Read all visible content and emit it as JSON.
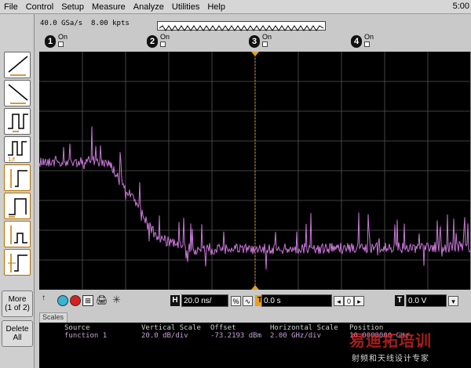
{
  "menu": {
    "items": [
      "File",
      "Control",
      "Setup",
      "Measure",
      "Analyze",
      "Utilities",
      "Help"
    ],
    "clock": "5:00"
  },
  "acquisition": {
    "sample_rate": "40.0 GSa/s",
    "record_length": "8.00 kpts"
  },
  "channels": [
    {
      "number": "1",
      "state": "On",
      "color": "#f0f0f0"
    },
    {
      "number": "2",
      "state": "On",
      "color": "#111111"
    },
    {
      "number": "3",
      "state": "On",
      "color": "#111111"
    },
    {
      "number": "4",
      "state": "On",
      "color": "#111111"
    }
  ],
  "left_toolbar": {
    "buttons": [
      "rising-edge-trigger-icon",
      "falling-edge-trigger-icon",
      "pulse-width-trigger-icon",
      "pulse-width-divide-trigger-icon",
      "transition-trigger-icon",
      "pattern-trigger-icon",
      "runt-trigger-icon",
      "setup-hold-trigger-icon"
    ],
    "more_label_line1": "More",
    "more_label_line2": "(1 of 2)",
    "delete_label_line1": "Delete",
    "delete_label_line2": "All"
  },
  "control_bar": {
    "horizontal_label": "H",
    "time_per_div": "20.0 ns/",
    "delay_value": "0.0 s",
    "delay_stepper": "0",
    "trigger_label": "T",
    "trigger_level": "0.0 V"
  },
  "scales": {
    "tab_label": "Scales",
    "headers": {
      "source": "Source",
      "vertical": "Vertical Scale",
      "offset": "Offset",
      "horizontal": "Horizontal Scale",
      "position": "Position"
    },
    "row": {
      "source": "function 1",
      "vertical": "20.0 dB/div",
      "offset": "-73.2193 dBm",
      "horizontal": "2.00 GHz/div",
      "position": "10.0000000 GHz"
    }
  },
  "watermark": {
    "line1": "易迪拓培训",
    "line2": "射频和天线设计专家"
  },
  "colors": {
    "trace": "#c878d8",
    "grid": "#555555",
    "marker": "#e0a020",
    "screen": "#000000"
  }
}
